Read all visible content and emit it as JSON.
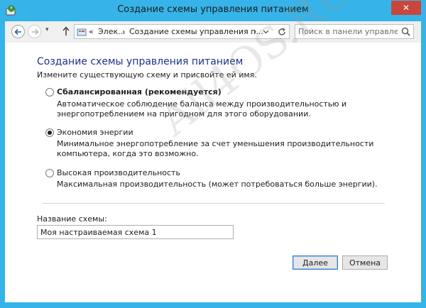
{
  "window": {
    "title": "Создание схемы управления питанием",
    "close_glyph": "✕",
    "accent": "#36b4e9",
    "close_color": "#c9463d"
  },
  "nav": {
    "back_icon": "arrow-left-icon",
    "forward_icon": "arrow-right-icon",
    "recent_glyph": "▾",
    "up_icon": "arrow-up-icon"
  },
  "address": {
    "chevron_glyph": "«",
    "crumb1": "Элек...",
    "separator": "›",
    "crumb2": "Создание схемы управления п...",
    "separator2": "›",
    "dropdown_glyph": "▾"
  },
  "search": {
    "placeholder": "Поиск в панели управления"
  },
  "content": {
    "title": "Создание схемы управления питанием",
    "subtitle": "Измените существующую схему и присвойте ей имя.",
    "options": [
      {
        "label": "Сбалансированная (рекомендуется)",
        "description": "Автоматическое соблюдение баланса между производительностью и энергопотреблением на пригодном для этого оборудовании.",
        "selected": false
      },
      {
        "label": "Экономия энергии",
        "description": "Минимальное энергопотребление за счет уменьшения производительности компьютера, когда это возможно.",
        "selected": true
      },
      {
        "label": "Высокая производительность",
        "description": "Максимальная производительность (может потребоваться больше энергии).",
        "selected": false
      }
    ],
    "name_label": "Название схемы:",
    "name_value": "Моя настраиваемая схема 1"
  },
  "buttons": {
    "next": "Далее",
    "cancel": "Отмена"
  },
  "watermark": "All4OS.RU"
}
